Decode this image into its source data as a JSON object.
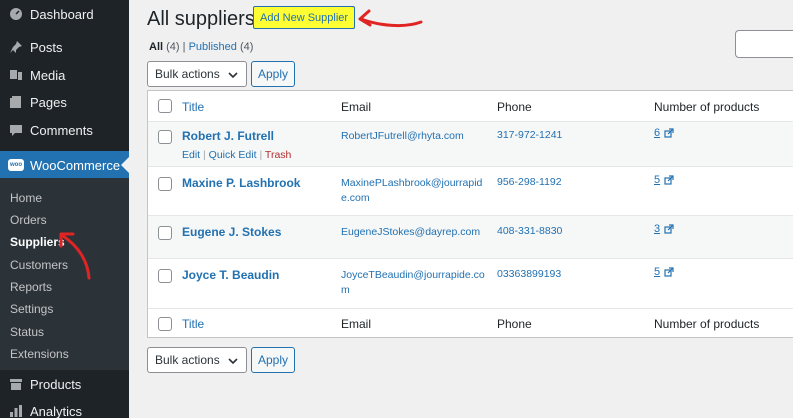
{
  "sidebar": {
    "top_items": [
      {
        "label": "Dashboard",
        "icon": "dashboard-icon"
      },
      {
        "label": "Posts",
        "icon": "pin-icon"
      },
      {
        "label": "Media",
        "icon": "media-icon"
      },
      {
        "label": "Pages",
        "icon": "pages-icon"
      },
      {
        "label": "Comments",
        "icon": "comments-icon"
      },
      {
        "label": "WooCommerce",
        "icon": "woocommerce-icon"
      }
    ],
    "woo_logo_text": "woo",
    "submenu": [
      "Home",
      "Orders",
      "Suppliers",
      "Customers",
      "Reports",
      "Settings",
      "Status",
      "Extensions"
    ],
    "bottom_items": [
      {
        "label": "Products",
        "icon": "products-icon"
      },
      {
        "label": "Analytics",
        "icon": "analytics-icon"
      }
    ]
  },
  "header": {
    "title": "All suppliers",
    "add_new_label": "Add New Supplier"
  },
  "filters": {
    "all_label": "All",
    "all_count": "(4)",
    "separator": "|",
    "published_label": "Published",
    "published_count": "(4)"
  },
  "bulk": {
    "actions_label": "Bulk actions",
    "apply_label": "Apply"
  },
  "table": {
    "columns": [
      "Title",
      "Email",
      "Phone",
      "Number of products"
    ],
    "rows": [
      {
        "title": "Robert J. Futrell",
        "email": "RobertJFutrell@rhyta.com",
        "phone": "317-972-1241",
        "num": "6"
      },
      {
        "title": "Maxine P. Lashbrook",
        "email_line1": "MaxinePLashbrook@jourrapid",
        "email_line2": "e.com",
        "phone": "956-298-1192",
        "num": "5"
      },
      {
        "title": "Eugene J. Stokes",
        "email": "EugeneJStokes@dayrep.com",
        "phone": "408-331-8830",
        "num": "3"
      },
      {
        "title": "Joyce T. Beaudin",
        "email_line1": "JoyceTBeaudin@jourrapide.co",
        "email_line2": "m",
        "phone": "03363899193",
        "num": "5"
      }
    ],
    "row_actions": {
      "edit": "Edit",
      "sep": "|",
      "quick_edit": "Quick Edit",
      "trash": "Trash"
    }
  },
  "colors": {
    "sidebar_bg": "#1d2327",
    "active_blue": "#2271b1",
    "highlight_yellow": "#ffff33",
    "annotation_red": "#e02424"
  }
}
